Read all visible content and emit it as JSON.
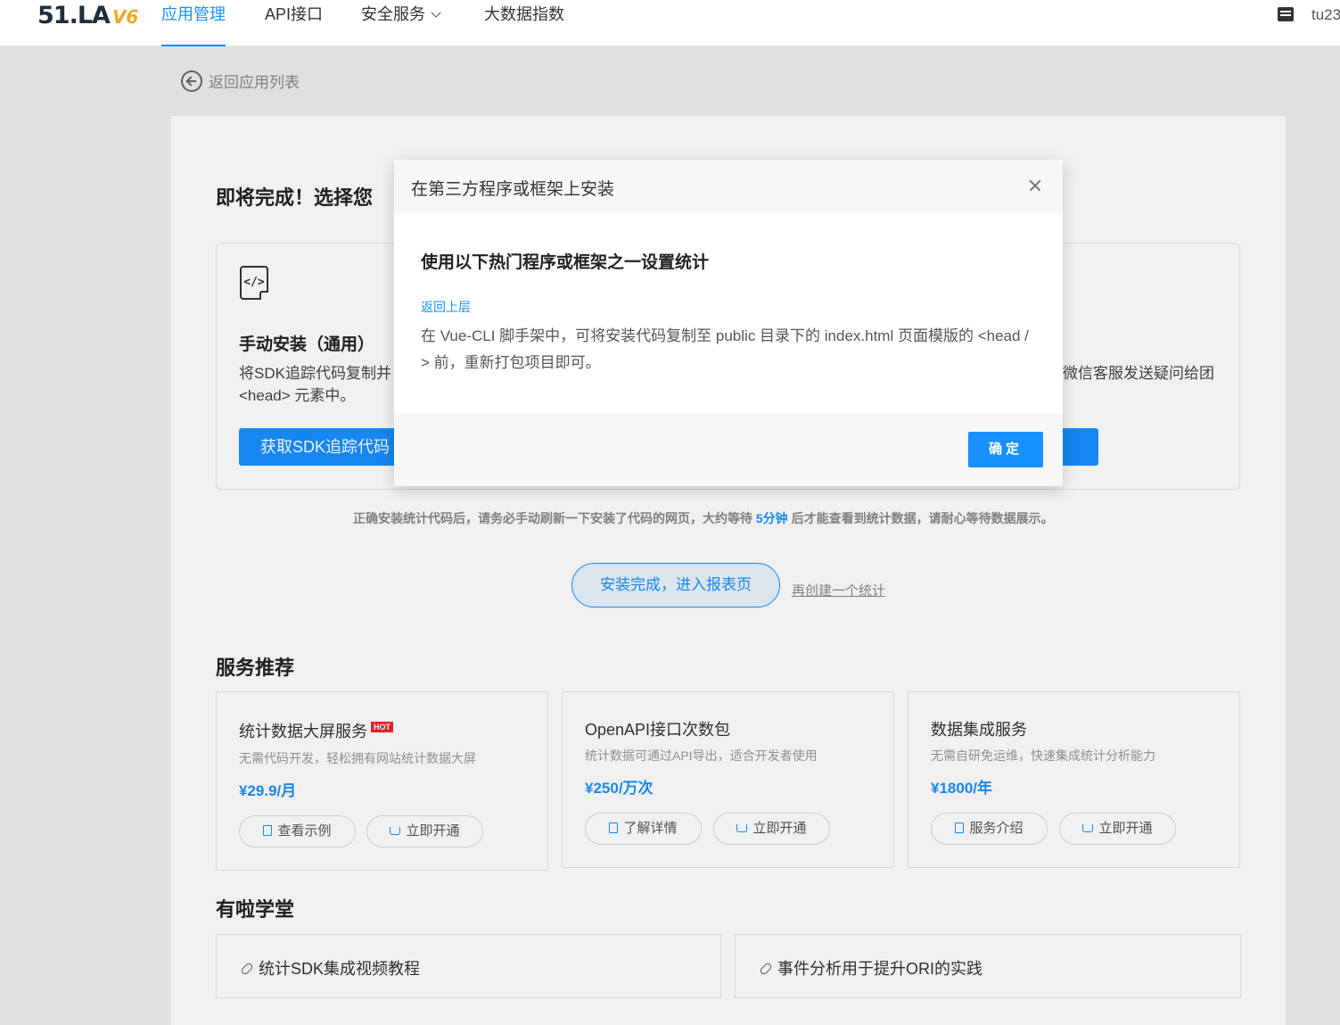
{
  "nav": {
    "logo_main": "51.LA",
    "logo_version": "V6",
    "items": [
      {
        "label": "应用管理",
        "active": true
      },
      {
        "label": "API接口"
      },
      {
        "label": "安全服务"
      },
      {
        "label": "大数据指数"
      }
    ],
    "user": "tu23"
  },
  "back_link": "返回应用列表",
  "step_title": "即将完成！选择您",
  "install": {
    "title": "手动安装（通用）",
    "desc_line1": "将SDK追踪代码复制并",
    "desc_line2": "<head> 元素中。",
    "button": "获取SDK追踪代码",
    "right_desc": "微信客服发送疑问给团"
  },
  "notice": {
    "before": "正确安装统计代码后，请务必手动刷新一下安装了代码的网页，大约等待 ",
    "highlight": "5分钟",
    "after": " 后才能查看到统计数据，请耐心等待数据展示。"
  },
  "done_button": "安装完成，进入报表页",
  "recreate_link": "再创建一个统计",
  "services": {
    "title": "服务推荐",
    "items": [
      {
        "name": "统计数据大屏服务",
        "badge": "HOT",
        "desc": "无需代码开发，轻松拥有网站统计数据大屏",
        "price": "¥29.9/月",
        "btn1": "查看示例",
        "btn2": "立即开通"
      },
      {
        "name": "OpenAPI接口次数包",
        "desc": "统计数据可通过API导出，适合开发者使用",
        "price": "¥250/万次",
        "btn1": "了解详情",
        "btn2": "立即开通"
      },
      {
        "name": "数据集成服务",
        "desc": "无需自研免运维，快速集成统计分析能力",
        "price": "¥1800/年",
        "btn1": "服务介绍",
        "btn2": "立即开通"
      }
    ]
  },
  "learn": {
    "title": "有啦学堂",
    "items": [
      {
        "label": "统计SDK集成视频教程"
      },
      {
        "label": "事件分析用于提升ORI的实践"
      }
    ]
  },
  "modal": {
    "title": "在第三方程序或框架上安装",
    "heading": "使用以下热门程序或框架之一设置统计",
    "back": "返回上层",
    "text": "在 Vue-CLI 脚手架中，可将安装代码复制至 public 目录下的 index.html 页面模版的 <head /> 前，重新打包项目即可。",
    "ok": "确定"
  },
  "colors": {
    "accent": "#1890ff",
    "hot": "#f5222d",
    "logo_version": "#f5a623"
  },
  "icons": [
    "back-arrow-icon",
    "code-file-icon",
    "message-icon",
    "close-icon",
    "document-icon",
    "cart-icon",
    "link-icon",
    "chevron-down-icon"
  ]
}
